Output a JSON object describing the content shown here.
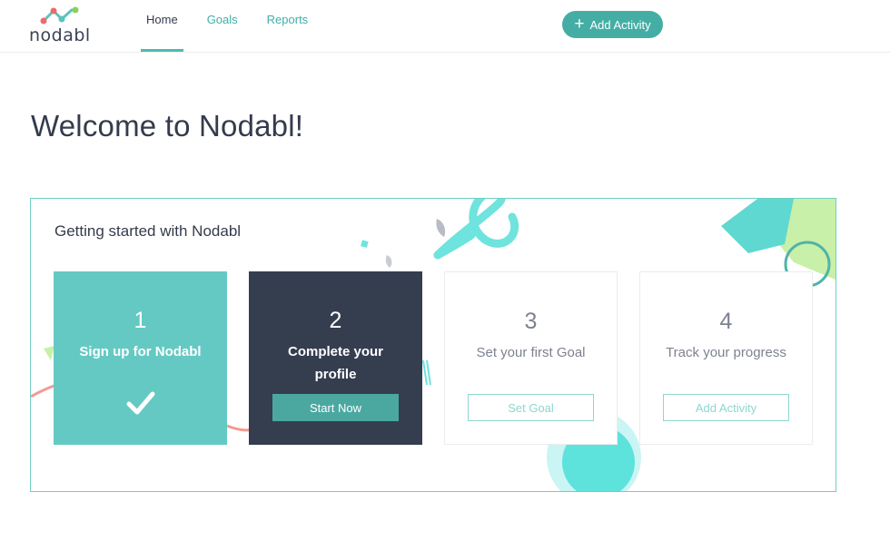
{
  "app": {
    "logo_text": "nodabl"
  },
  "nav": {
    "items": [
      {
        "label": "Home",
        "active": true
      },
      {
        "label": "Goals",
        "active": false
      },
      {
        "label": "Reports",
        "active": false
      }
    ],
    "add_activity_label": "Add Activity"
  },
  "page": {
    "title": "Welcome to Nodabl!"
  },
  "getting_started": {
    "title": "Getting started with Nodabl",
    "steps": [
      {
        "number": "1",
        "label": "Sign up for Nodabl",
        "status": "done"
      },
      {
        "number": "2",
        "label": "Complete your profile",
        "button": "Start Now"
      },
      {
        "number": "3",
        "label": "Set your first Goal",
        "button": "Set Goal"
      },
      {
        "number": "4",
        "label": "Track your progress",
        "button": "Add Activity"
      }
    ]
  },
  "colors": {
    "accent": "#44aea5",
    "dark": "#353e4f",
    "teal_light": "#65c9c3"
  }
}
